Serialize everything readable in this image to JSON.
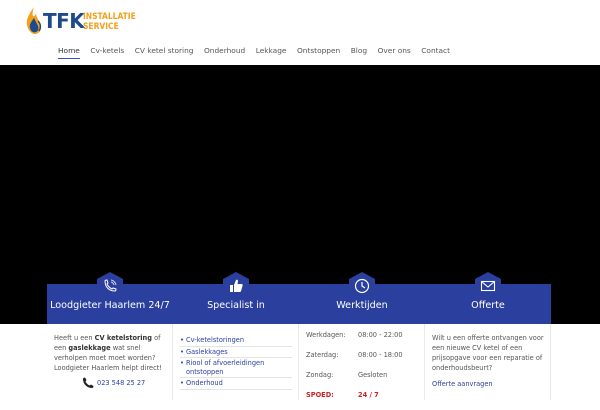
{
  "brand": {
    "name": "TFK",
    "sub_line1": "INSTALLATIE",
    "sub_line2": "SERVICE",
    "colors": {
      "primary": "#1c4a8c",
      "accent": "#f0a11c"
    }
  },
  "nav": {
    "items": [
      {
        "label": "Home",
        "active": true
      },
      {
        "label": "Cv-ketels"
      },
      {
        "label": "CV ketel storing"
      },
      {
        "label": "Onderhoud"
      },
      {
        "label": "Lekkage"
      },
      {
        "label": "Ontstoppen"
      },
      {
        "label": "Blog"
      },
      {
        "label": "Over ons"
      },
      {
        "label": "Contact"
      }
    ]
  },
  "theme": {
    "card_color": "#2a3f9e",
    "hero_color": "#000000"
  },
  "cards": {
    "c1": {
      "icon": "phone-icon",
      "title": "Loodgieter Haarlem 24/7",
      "text_a": "Heeft u een ",
      "text_b": "CV ketelstoring",
      "text_c": " of een ",
      "text_d": "gaslekkage",
      "text_e": " wat snel verholpen moet moet worden? Loodgieter Haarlem helpt direct!",
      "phone": "023 548 25 27"
    },
    "c2": {
      "icon": "thumbs-up-icon",
      "title": "Specialist in",
      "items": [
        "Cv-ketelstoringen",
        "Gaslekkages",
        "Riool of afvoerleidingen ontstoppen",
        "Onderhoud"
      ]
    },
    "c3": {
      "icon": "clock-icon",
      "title": "Werktijden",
      "rows": [
        {
          "day": "Werkdagen:",
          "time": "08:00 - 22:00"
        },
        {
          "day": "Zaterdag:",
          "time": "08:00 - 18:00"
        },
        {
          "day": "Zondag:",
          "time": "Gesloten"
        },
        {
          "day": "SPOED:",
          "time": "24 / 7"
        }
      ]
    },
    "c4": {
      "icon": "envelope-icon",
      "title": "Offerte",
      "text": "Wilt u een offerte ontvangen voor een nieuwe CV ketel of een prijsopgave voor een reparatie of onderhoudsbeurt?",
      "link": "Offerte aanvragen"
    }
  }
}
